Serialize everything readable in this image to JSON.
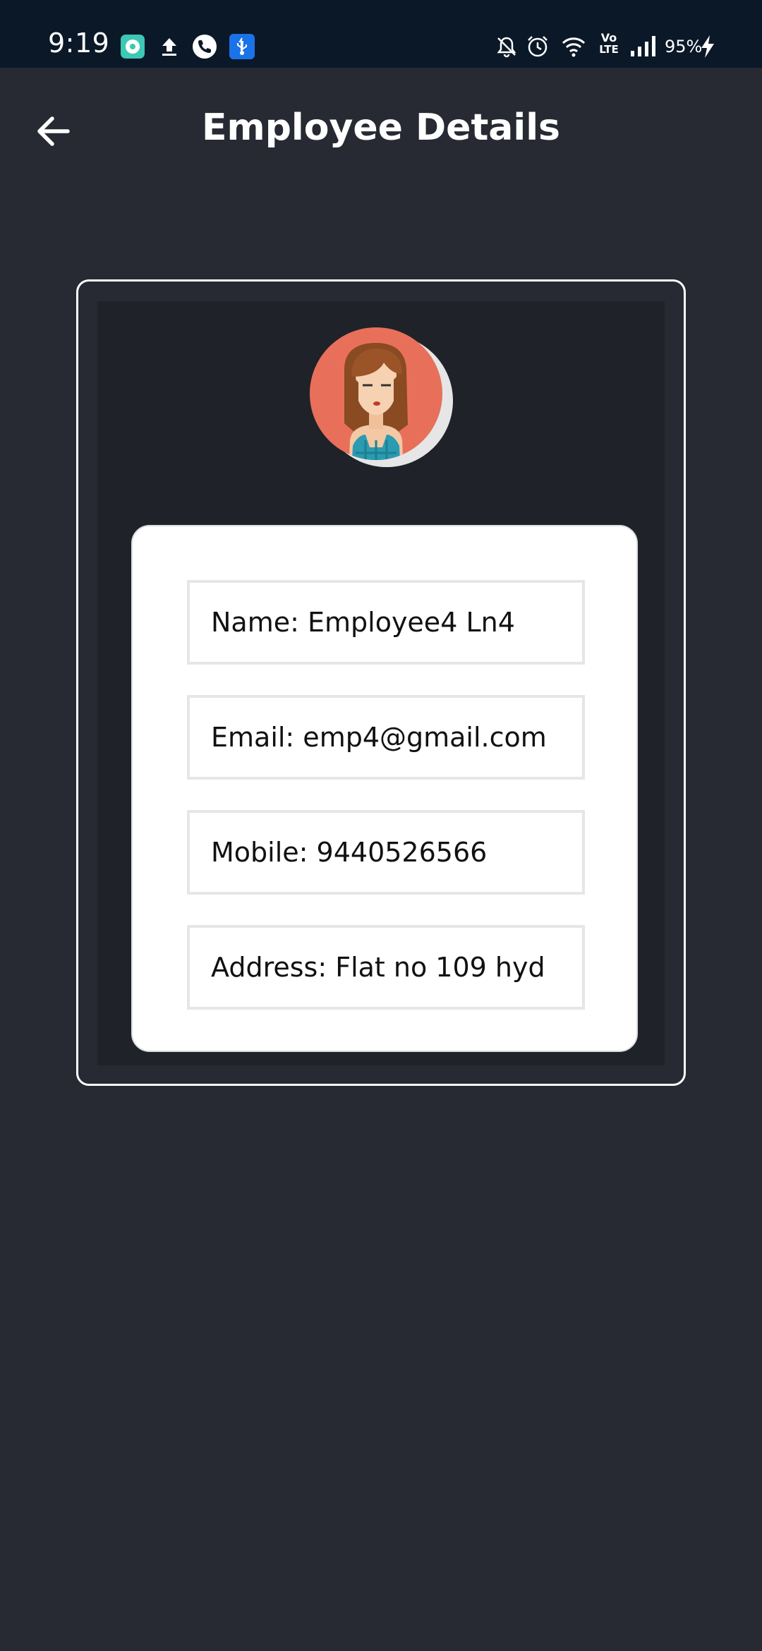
{
  "status_bar": {
    "time": "9:19",
    "battery": "95%",
    "icons": [
      "app-notification-icon",
      "upload-icon",
      "phone-call-icon",
      "usb-icon",
      "notifications-off-icon",
      "alarm-icon",
      "wifi-icon",
      "volte-icon",
      "signal-icon",
      "charging-icon"
    ],
    "volte_line1": "Vo",
    "volte_line2": "LTE"
  },
  "app_bar": {
    "title": "Employee Details",
    "back_icon": "arrow-left-icon"
  },
  "colors": {
    "background": "#272a33",
    "status_bar": "#0b1828",
    "card_inner": "#1f2229",
    "avatar_circle": "#e8705a",
    "field_border": "#e4e6e9"
  },
  "employee": {
    "avatar": "female-avatar",
    "name": "Name: Employee4 Ln4",
    "email": "Email: emp4@gmail.com",
    "mobile": "Mobile: 9440526566",
    "address": "Address: Flat no 109 hyd"
  }
}
